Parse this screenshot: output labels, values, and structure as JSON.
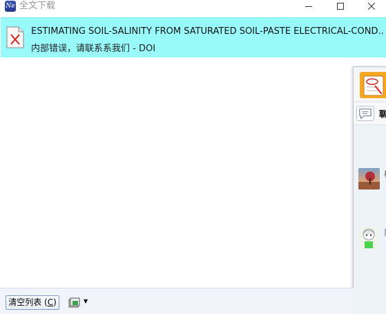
{
  "window": {
    "title": "全文下载",
    "app_icon_text": "Ne"
  },
  "download_item": {
    "title": "ESTIMATING SOIL-SALINITY FROM SATURATED SOIL-PASTE ELECTRICAL-COND...",
    "status": "内部错误，请联系系我们  -  DOI",
    "icon": "pdf-error-icon",
    "highlight_color": "#99fafc"
  },
  "toolbar": {
    "clear_label": "清空列表 (",
    "clear_hotkey": "C",
    "clear_suffix": ")",
    "tool_icon": "folder-settings-icon"
  },
  "side_panel": {
    "chat_label": "聊",
    "contacts": [
      {
        "name": "相",
        "avatar": "tree-avatar"
      },
      {
        "name": "梁",
        "avatar": "anime-avatar"
      }
    ]
  },
  "colors": {
    "title_text": "#999999",
    "row_highlight": "#99fafc",
    "toolbar_bg": "#f1f4fa"
  }
}
